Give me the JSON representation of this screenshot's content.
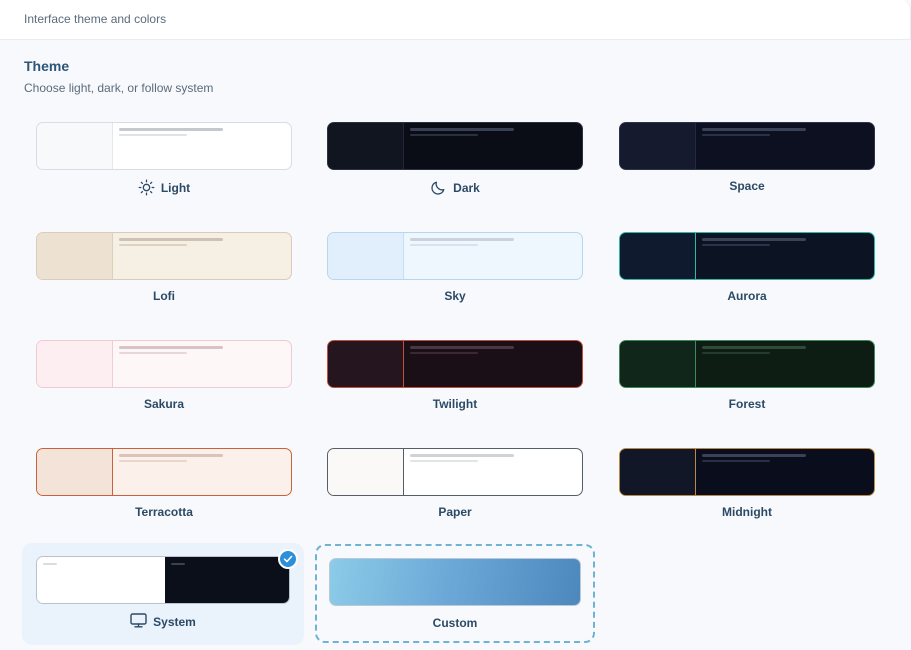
{
  "header": {
    "title": "Interface theme and colors"
  },
  "section": {
    "title": "Theme",
    "subtitle": "Choose light, dark, or follow system"
  },
  "themes": [
    {
      "id": "light",
      "label": "Light",
      "icon": "sun-icon",
      "sidebar": "#f7f9fb",
      "main": "#ffffff",
      "border": "#d5dde6",
      "divider": "#e3e8ee",
      "line": "#c5c9ce",
      "line2": "#e0e3e6"
    },
    {
      "id": "dark",
      "label": "Dark",
      "icon": "moon-icon",
      "sidebar": "#111520",
      "main": "#0a0d16",
      "border": "#2a3140",
      "divider": "#222838",
      "line": "#3a4152",
      "line2": "#2a303e"
    },
    {
      "id": "space",
      "label": "Space",
      "icon": "",
      "sidebar": "#151a2e",
      "main": "#0c1020",
      "border": "#2d3448",
      "divider": "#232a40",
      "line": "#3a4258",
      "line2": "#2b3246"
    },
    {
      "id": "lofi",
      "label": "Lofi",
      "icon": "",
      "sidebar": "#ede2d2",
      "main": "#f6efe4",
      "border": "#d9ccb9",
      "divider": "#dccfbc",
      "line": "#cfc2b0",
      "line2": "#ddd2c2"
    },
    {
      "id": "sky",
      "label": "Sky",
      "icon": "",
      "sidebar": "#e1eefc",
      "main": "#eef6fe",
      "border": "#b8d6ee",
      "divider": "#c8dff2",
      "line": "#c8d3de",
      "line2": "#d8e2ec"
    },
    {
      "id": "aurora",
      "label": "Aurora",
      "icon": "",
      "sidebar": "#0f1a2e",
      "main": "#0c1424",
      "border": "#2fb8a8",
      "divider": "#2fb8a8",
      "line": "#3a4558",
      "line2": "#2b3446"
    },
    {
      "id": "sakura",
      "label": "Sakura",
      "icon": "",
      "sidebar": "#fdeef1",
      "main": "#fef7f8",
      "border": "#f2c9d3",
      "divider": "#f0cdd6",
      "line": "#d9c2c8",
      "line2": "#e8d6da"
    },
    {
      "id": "twilight",
      "label": "Twilight",
      "icon": "",
      "sidebar": "#24151f",
      "main": "#1b0f17",
      "border": "#c2503f",
      "divider": "#c2503f",
      "line": "#4a3540",
      "line2": "#3a2932"
    },
    {
      "id": "forest",
      "label": "Forest",
      "icon": "",
      "sidebar": "#11261a",
      "main": "#0d1d14",
      "border": "#3f8a5a",
      "divider": "#3f8a5a",
      "line": "#2f4a38",
      "line2": "#253b2d"
    },
    {
      "id": "terracotta",
      "label": "Terracotta",
      "icon": "",
      "sidebar": "#f4e3d8",
      "main": "#fbf1ea",
      "border": "#c8623a",
      "divider": "#c8623a",
      "line": "#d8c4b8",
      "line2": "#e6d6cc"
    },
    {
      "id": "paper",
      "label": "Paper",
      "icon": "",
      "sidebar": "#faf9f7",
      "main": "#ffffff",
      "border": "#555d66",
      "divider": "#555d66",
      "line": "#d0d3d6",
      "line2": "#e2e4e6"
    },
    {
      "id": "midnight",
      "label": "Midnight",
      "icon": "",
      "sidebar": "#111727",
      "main": "#0a0e1c",
      "border": "#b98a4a",
      "divider": "#b98a4a",
      "line": "#3a4158",
      "line2": "#2a3044"
    }
  ],
  "system_theme": {
    "label": "System",
    "icon": "monitor-icon",
    "selected": true
  },
  "custom_theme": {
    "label": "Custom"
  },
  "colors": {
    "accent": "#2b90d9",
    "custom_border": "#6fb3d2"
  }
}
